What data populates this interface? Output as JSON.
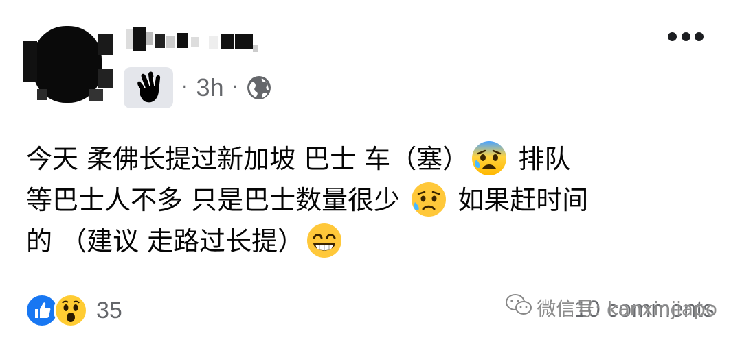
{
  "post": {
    "time": "3h",
    "separator": "·",
    "badge_icon": "waving-hand-icon",
    "audience_icon": "globe-icon",
    "more_icon": "more-options-icon",
    "text": {
      "line1_a": "今天 柔佛长提过新加坡 巴士 车（塞）",
      "line1_emoji": "anxious-face-with-sweat",
      "line1_b": " 排队",
      "line2_a": "等巴士人不多 只是巴士数量很少 ",
      "line2_emoji": "sad-relieved-face",
      "line2_b": " 如果赶时间",
      "line3_a": "的 （建议 走路过长提）",
      "line3_emoji": "grinning-face-with-smiling-eyes"
    }
  },
  "footer": {
    "reactions": [
      "like-reaction-icon",
      "wow-reaction-icon"
    ],
    "reaction_count": "35",
    "comments": "10 comments"
  },
  "watermark": {
    "text": "微信号: kanxinjiapo",
    "icon": "wechat-icon"
  },
  "colors": {
    "secondary_text": "#65676b",
    "primary_text": "#050505",
    "like_blue": "#1877f2",
    "badge_bg": "#e4e6eb"
  }
}
